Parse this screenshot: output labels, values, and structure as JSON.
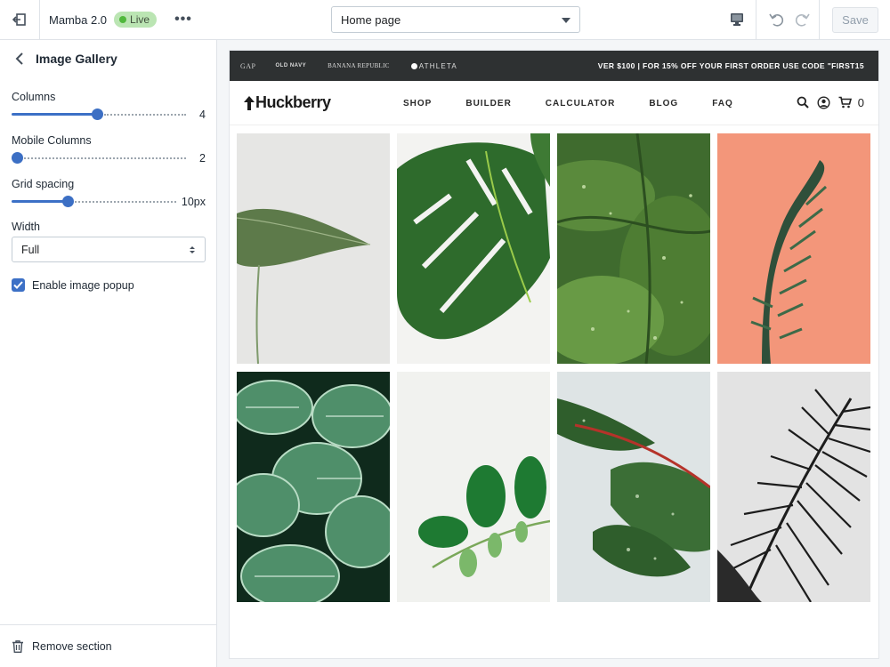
{
  "topbar": {
    "theme_name": "Mamba 2.0",
    "status_badge": "Live",
    "page_select_value": "Home page",
    "save_label": "Save"
  },
  "sidebar": {
    "title": "Image Gallery",
    "columns": {
      "label": "Columns",
      "value": "4",
      "fraction": 0.49
    },
    "mobile_columns": {
      "label": "Mobile Columns",
      "value": "2",
      "fraction": 0.03
    },
    "grid_spacing": {
      "label": "Grid spacing",
      "value": "10px",
      "fraction": 0.34
    },
    "width": {
      "label": "Width",
      "value": "Full"
    },
    "popup_checkbox": {
      "label": "Enable image popup",
      "checked": true
    },
    "remove_label": "Remove section"
  },
  "preview": {
    "brands": [
      "GAP",
      "OLD NAVY",
      "BANANA REPUBLIC",
      "ATHLETA"
    ],
    "promo_text": "VER $100 | FOR 15% OFF YOUR FIRST ORDER USE CODE \"FIRST15",
    "logo": "Huckberry",
    "nav_links": [
      "SHOP",
      "BUILDER",
      "CALCULATOR",
      "BLOG",
      "FAQ"
    ],
    "cart_count": "0",
    "gallery_images": [
      "single-leaf-grey-photo",
      "monstera-leaf-photo",
      "hosta-dew-photo",
      "fern-coral-photo",
      "calathea-photo",
      "zz-plant-branch-photo",
      "wet-leaves-photo",
      "palm-frond-bw-photo"
    ]
  },
  "colors": {
    "accent": "#3c70c6",
    "live_badge_bg": "#bbe5b3",
    "promo_bar": "#2e3132"
  }
}
